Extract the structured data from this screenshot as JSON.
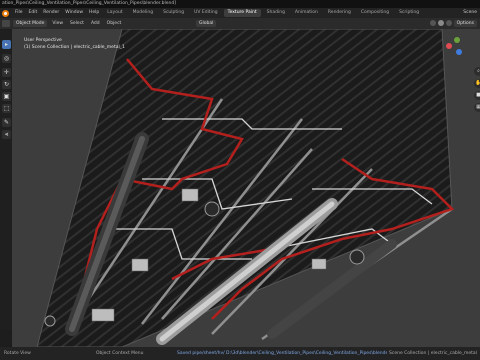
{
  "window": {
    "title": "ation_Pipes\\Ceiling_Ventilation_Pipes\\Ceiling_Ventilation_Pipes\\blender.blend]"
  },
  "menu": {
    "items": [
      "File",
      "Edit",
      "Render",
      "Window",
      "Help"
    ]
  },
  "workspace_tabs": [
    {
      "label": "Layout",
      "active": false
    },
    {
      "label": "Modeling",
      "active": false
    },
    {
      "label": "Sculpting",
      "active": false
    },
    {
      "label": "UV Editing",
      "active": false
    },
    {
      "label": "Texture Paint",
      "active": true
    },
    {
      "label": "Shading",
      "active": false
    },
    {
      "label": "Animation",
      "active": false
    },
    {
      "label": "Rendering",
      "active": false
    },
    {
      "label": "Compositing",
      "active": false
    },
    {
      "label": "Scripting",
      "active": false
    }
  ],
  "scene_label": "Scene",
  "viewport_header": {
    "mode": "Object Mode",
    "menus": [
      "View",
      "Select",
      "Add",
      "Object"
    ],
    "orientation": "Global",
    "options": "Options"
  },
  "viewport": {
    "perspective": "User Perspective",
    "collection": "(1) Scene Collection | electric_cable_metal_1"
  },
  "status": {
    "left": "Rotate View",
    "middle": "Object Context Menu",
    "path": "Saved pipe/sheet/hv/ D:\\3d\\blender\\Ceiling_Ventilation_Pipes\\Ceiling_Ventilation_Pipes\\blender\\textures\\texture_hud.png",
    "right": "Scene Collection | electric_cable_metal_1 | Verts"
  },
  "colors": {
    "accent": "#4772b3",
    "cable_red": "#b3201d",
    "blender_orange": "#e87d0d"
  }
}
